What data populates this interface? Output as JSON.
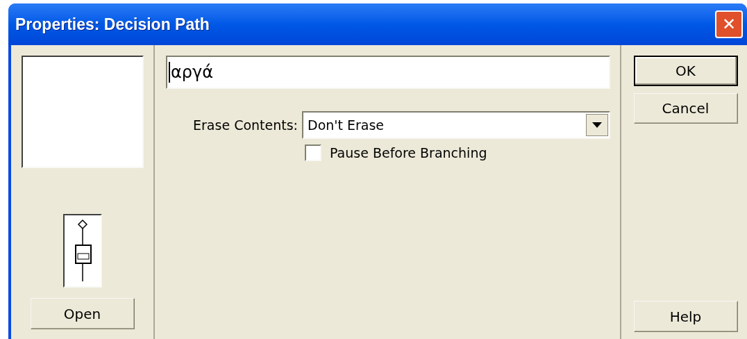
{
  "window": {
    "title": "Properties: Decision Path",
    "close_glyph": "✕"
  },
  "left_panel": {
    "open_button": {
      "label": "Open",
      "default": false
    }
  },
  "name_field": {
    "value": "αργά"
  },
  "erase_contents": {
    "label": "Erase Contents:",
    "value": "Don't Erase"
  },
  "pause_before_branching": {
    "label": "Pause Before Branching",
    "checked": false
  },
  "buttons": [
    {
      "label": "OK",
      "default": true
    },
    {
      "label": "Cancel",
      "default": false
    }
  ],
  "help_button": {
    "label": "Help",
    "default": false
  }
}
